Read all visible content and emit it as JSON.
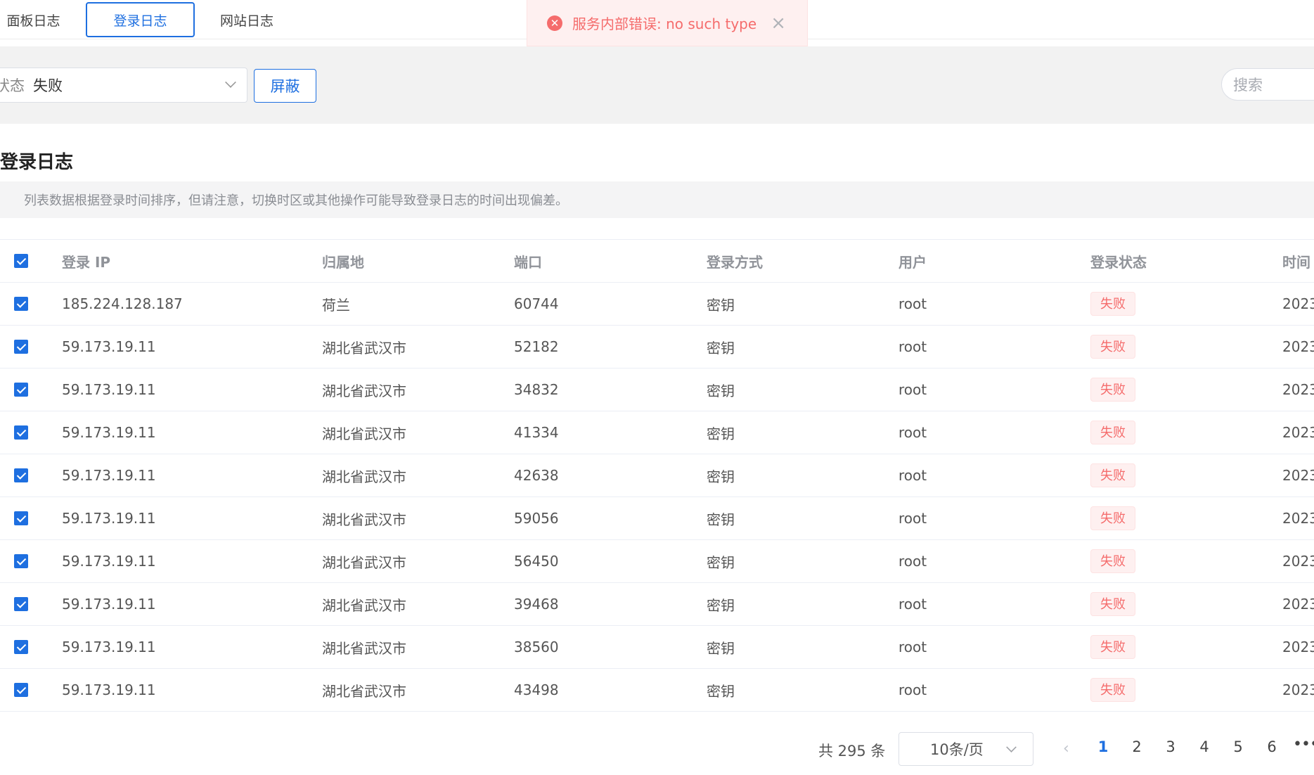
{
  "tabs": [
    {
      "label": "面板日志",
      "active": false
    },
    {
      "label": "登录日志",
      "active": true
    },
    {
      "label": "网站日志",
      "active": false
    }
  ],
  "message": {
    "text": "服务内部错误: no such type",
    "icon": "error-circle-icon",
    "close_icon": "close-icon",
    "color": "#f56c6c"
  },
  "filter": {
    "status_prefix": "状态",
    "status_value": "失败",
    "shield_button": "屏蔽",
    "search_placeholder": "搜索"
  },
  "section": {
    "title": "登录日志",
    "notice": "列表数据根据登录时间排序，但请注意，切换时区或其他操作可能导致登录日志的时间出现偏差。"
  },
  "table": {
    "columns": [
      "登录 IP",
      "归属地",
      "端口",
      "登录方式",
      "用户",
      "登录状态",
      "时间"
    ],
    "rows": [
      {
        "ip": "185.224.128.187",
        "location": "荷兰",
        "port": "60744",
        "method": "密钥",
        "user": "root",
        "status": "失败",
        "time": "2023"
      },
      {
        "ip": "59.173.19.11",
        "location": "湖北省武汉市",
        "port": "52182",
        "method": "密钥",
        "user": "root",
        "status": "失败",
        "time": "2023"
      },
      {
        "ip": "59.173.19.11",
        "location": "湖北省武汉市",
        "port": "34832",
        "method": "密钥",
        "user": "root",
        "status": "失败",
        "time": "2023"
      },
      {
        "ip": "59.173.19.11",
        "location": "湖北省武汉市",
        "port": "41334",
        "method": "密钥",
        "user": "root",
        "status": "失败",
        "time": "2023"
      },
      {
        "ip": "59.173.19.11",
        "location": "湖北省武汉市",
        "port": "42638",
        "method": "密钥",
        "user": "root",
        "status": "失败",
        "time": "2023"
      },
      {
        "ip": "59.173.19.11",
        "location": "湖北省武汉市",
        "port": "59056",
        "method": "密钥",
        "user": "root",
        "status": "失败",
        "time": "2023"
      },
      {
        "ip": "59.173.19.11",
        "location": "湖北省武汉市",
        "port": "56450",
        "method": "密钥",
        "user": "root",
        "status": "失败",
        "time": "2023"
      },
      {
        "ip": "59.173.19.11",
        "location": "湖北省武汉市",
        "port": "39468",
        "method": "密钥",
        "user": "root",
        "status": "失败",
        "time": "2023"
      },
      {
        "ip": "59.173.19.11",
        "location": "湖北省武汉市",
        "port": "38560",
        "method": "密钥",
        "user": "root",
        "status": "失败",
        "time": "2023"
      },
      {
        "ip": "59.173.19.11",
        "location": "湖北省武汉市",
        "port": "43498",
        "method": "密钥",
        "user": "root",
        "status": "失败",
        "time": "2023"
      }
    ]
  },
  "pagination": {
    "total": "共 295 条",
    "page_size": "10条/页",
    "pages": [
      "1",
      "2",
      "3",
      "4",
      "5",
      "6"
    ],
    "current": "1",
    "more": "•••"
  },
  "colors": {
    "primary": "#1e6fe0",
    "danger": "#f56c6c"
  }
}
